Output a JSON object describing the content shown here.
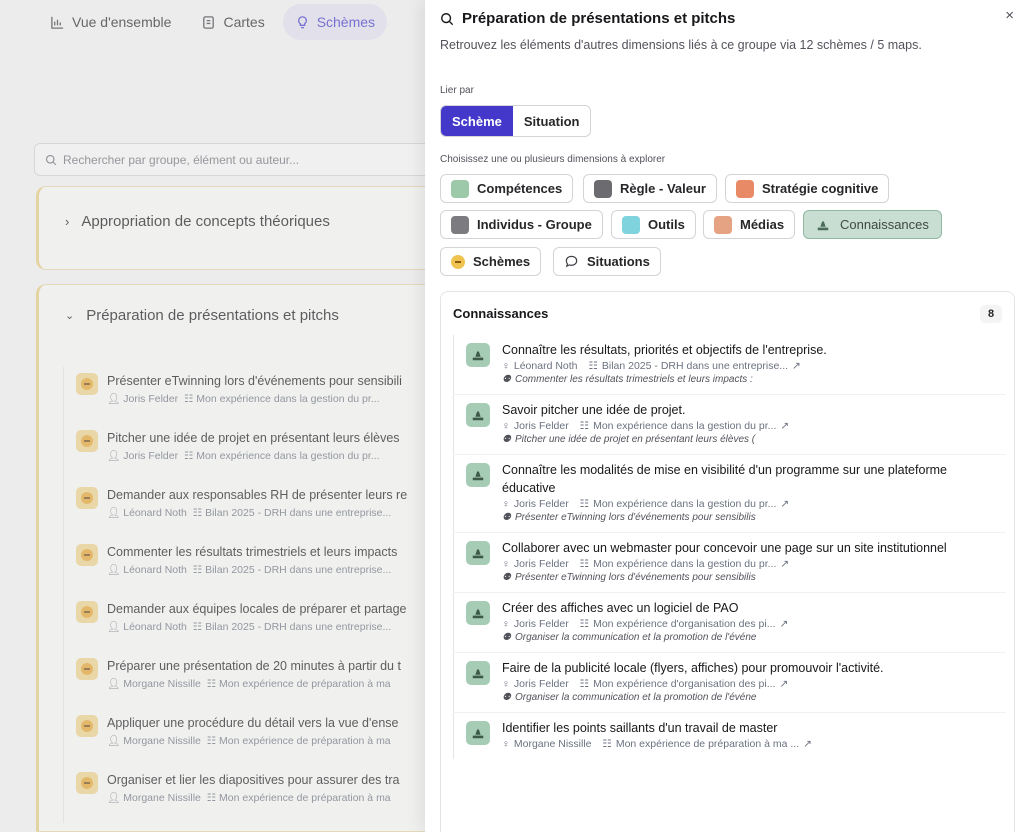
{
  "nav": {
    "tabs": [
      {
        "label": "Vue d'ensemble",
        "icon": "bar-chart-icon",
        "active": false
      },
      {
        "label": "Cartes",
        "icon": "document-icon",
        "active": false
      },
      {
        "label": "Schèmes",
        "icon": "lightbulb-icon",
        "active": true
      }
    ]
  },
  "search": {
    "placeholder": "Rechercher par groupe, élément ou auteur..."
  },
  "groups": [
    {
      "title": "Appropriation de concepts théoriques",
      "expanded": false
    },
    {
      "title": "Préparation de présentations et pitchs",
      "expanded": true
    }
  ],
  "group_items": [
    {
      "title": "Présenter eTwinning lors d'événements pour sensibili",
      "author": "Joris Felder",
      "map": "Mon expérience dans la gestion du pr..."
    },
    {
      "title": "Pitcher une idée de projet en présentant leurs élèves",
      "author": "Joris Felder",
      "map": "Mon expérience dans la gestion du pr..."
    },
    {
      "title": "Demander aux responsables RH de présenter leurs re",
      "author": "Léonard Noth",
      "map": "Bilan 2025 - DRH dans une entreprise..."
    },
    {
      "title": "Commenter les résultats trimestriels et leurs impacts",
      "author": "Léonard Noth",
      "map": "Bilan 2025 - DRH dans une entreprise..."
    },
    {
      "title": "Demander aux équipes locales de préparer et partage",
      "author": "Léonard Noth",
      "map": "Bilan 2025 - DRH dans une entreprise..."
    },
    {
      "title": "Préparer une présentation de 20 minutes à partir du t",
      "author": "Morgane Nissille",
      "map": "Mon expérience de préparation à ma"
    },
    {
      "title": "Appliquer une procédure du détail vers la vue d'ense",
      "author": "Morgane Nissille",
      "map": "Mon expérience de préparation à ma"
    },
    {
      "title": "Organiser et lier les diapositives pour assurer des tra",
      "author": "Morgane Nissille",
      "map": "Mon expérience de préparation à ma"
    }
  ],
  "panel": {
    "title": "Préparation de présentations et pitchs",
    "subtitle": "Retrouvez les éléments d'autres dimensions liés à ce groupe via 12 schèmes / 5 maps.",
    "close": "×",
    "link_label": "Lier par",
    "link_options": [
      {
        "label": "Schème",
        "selected": true
      },
      {
        "label": "Situation",
        "selected": false
      }
    ],
    "dimensions_label": "Choisissez une ou plusieurs dimensions à explorer",
    "dimensions": [
      {
        "label": "Compétences",
        "color": "#9cc9a9",
        "selected": false
      },
      {
        "label": "Règle - Valeur",
        "color": "#6b6b70",
        "selected": false
      },
      {
        "label": "Stratégie cognitive",
        "color": "#e98a66",
        "selected": false
      },
      {
        "label": "Individus - Groupe",
        "color": "#7b7b80",
        "selected": false
      },
      {
        "label": "Outils",
        "color": "#7fd3dc",
        "selected": false
      },
      {
        "label": "Médias",
        "color": "#e6a383",
        "selected": false
      },
      {
        "label": "Connaissances",
        "color": "#8fb9a2",
        "selected": true
      },
      {
        "label": "Schèmes",
        "color": "#f0c24f",
        "selected": false
      },
      {
        "label": "Situations",
        "color": "#ffffff",
        "selected": false
      }
    ],
    "results": {
      "title": "Connaissances",
      "count": "8",
      "items": [
        {
          "title": "Connaître les résultats, priorités et objectifs de l'entreprise.",
          "author": "Léonard Noth",
          "map": "Bilan 2025 - DRH dans une entreprise...",
          "scheme": "Commenter les résultats trimestriels et leurs impacts :"
        },
        {
          "title": "Savoir pitcher une idée de projet.",
          "author": "Joris Felder",
          "map": "Mon expérience dans la gestion du pr...",
          "scheme": "Pitcher une idée de projet en présentant leurs élèves ("
        },
        {
          "title": "Connaître les modalités de mise en visibilité d'un programme sur une plateforme éducative",
          "author": "Joris Felder",
          "map": "Mon expérience dans la gestion du pr...",
          "scheme": "Présenter eTwinning lors d'événements pour sensibilis"
        },
        {
          "title": "Collaborer avec un webmaster pour concevoir une page sur un site institutionnel",
          "author": "Joris Felder",
          "map": "Mon expérience dans la gestion du pr...",
          "scheme": "Présenter eTwinning lors d'événements pour sensibilis"
        },
        {
          "title": "Créer des affiches avec un logiciel de PAO",
          "author": "Joris Felder",
          "map": "Mon expérience d'organisation des pi...",
          "scheme": "Organiser la communication et la promotion de l'événe"
        },
        {
          "title": "Faire de la publicité locale (flyers, affiches) pour promouvoir l'activité.",
          "author": "Joris Felder",
          "map": "Mon expérience d'organisation des pi...",
          "scheme": "Organiser la communication et la promotion de l'événe"
        },
        {
          "title": "Identifier les points saillants d'un travail de master",
          "author": "Morgane Nissille",
          "map": "Mon expérience de préparation à ma ...",
          "scheme": ""
        }
      ]
    }
  }
}
